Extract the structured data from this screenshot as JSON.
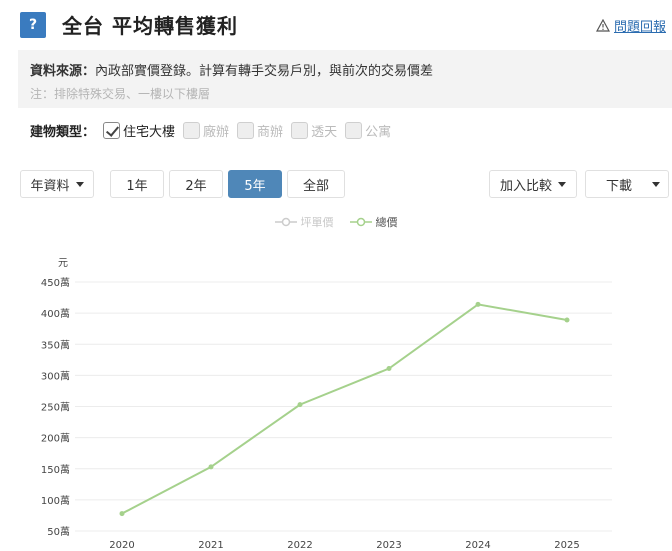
{
  "header": {
    "help_symbol": "?",
    "title": "全台 平均轉售獲利",
    "report_label": "問題回報",
    "report_icon": "warning-triangle-icon"
  },
  "info": {
    "source_label": "資料來源：",
    "source_text": "內政部實價登錄。計算有轉手交易戶別，與前次的交易價差",
    "note": "注：排除特殊交易、一樓以下樓層"
  },
  "building_types": {
    "label": "建物類型：",
    "options": [
      {
        "label": "住宅大樓",
        "checked": true
      },
      {
        "label": "廠辦",
        "checked": false
      },
      {
        "label": "商辦",
        "checked": false
      },
      {
        "label": "透天",
        "checked": false
      },
      {
        "label": "公寓",
        "checked": false
      }
    ]
  },
  "controls": {
    "dataset_select": "年資料",
    "ranges": [
      "1年",
      "2年",
      "5年",
      "全部"
    ],
    "active_range": "5年",
    "compare_label": "加入比較",
    "download_label": "下載"
  },
  "colors": {
    "accent": "#4f87b8",
    "series_line": "#a5d18c",
    "series_off": "#cccccc"
  },
  "chart_data": {
    "type": "line",
    "legend": [
      {
        "name": "坪單價",
        "enabled": false
      },
      {
        "name": "總價",
        "enabled": true
      }
    ],
    "ylabel": "元",
    "y_ticks": [
      "50萬",
      "100萬",
      "150萬",
      "200萬",
      "250萬",
      "300萬",
      "350萬",
      "400萬",
      "450萬"
    ],
    "ylim": [
      50,
      450
    ],
    "y_unit": "萬",
    "categories": [
      "2020",
      "2021",
      "2022",
      "2023",
      "2024",
      "2025"
    ],
    "series": [
      {
        "name": "總價",
        "values": [
          78,
          153,
          253,
          311,
          414,
          389
        ]
      }
    ],
    "grid": true
  }
}
